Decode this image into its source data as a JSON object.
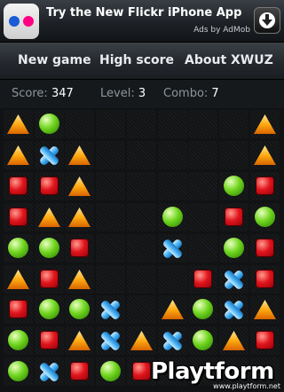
{
  "ad": {
    "title": "Try the New Flickr iPhone App",
    "subtitle": "Ads by AdMob",
    "logo_icon": "flickr-logo-icon",
    "download_icon": "download-arrow-icon"
  },
  "menu": {
    "new_game": "New game",
    "high_score": "High score",
    "about": "About XWUZ"
  },
  "stats": {
    "score_label": "Score:",
    "score_value": "347",
    "level_label": "Level:",
    "level_value": "3",
    "combo_label": "Combo:",
    "combo_value": "7"
  },
  "board": {
    "cols": 9,
    "rows": 9,
    "legend": {
      "T": "orange-triangle",
      "B": "green-ball",
      "S": "red-square",
      "X": "blue-cross",
      ".": "empty"
    },
    "grid": [
      "TB......T",
      "TXT.....T",
      "SST....BS",
      "STT..B.SB",
      "BBS..X.BS",
      "TST...SXS",
      "SBBX.TBXT",
      "BSTXTXBTS",
      "BXSBS...."
    ]
  },
  "watermark": {
    "brand": "Playtform",
    "url": "www.playtform.net"
  },
  "colors": {
    "background": "#101214",
    "accent_red": "#e0141c",
    "accent_orange": "#ffab12",
    "accent_green": "#6fd51d",
    "accent_blue": "#4fb4f5"
  }
}
